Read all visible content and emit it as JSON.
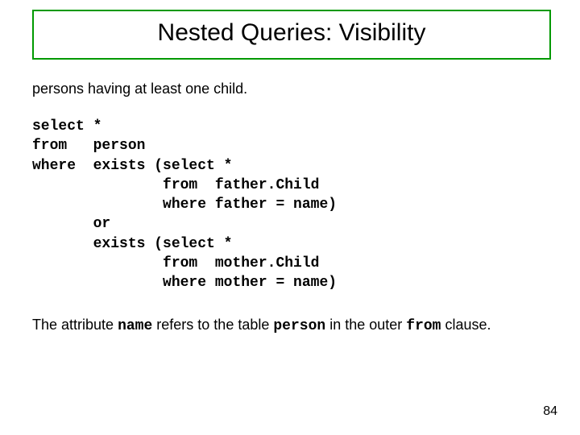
{
  "title": "Nested Queries: Visibility",
  "intro": "persons having at least one child.",
  "code": "select *\nfrom   person\nwhere  exists (select *\n               from  father.Child\n               where father = name)\n       or\n       exists (select *\n               from  mother.Child\n               where mother = name)",
  "note": {
    "p1": "The attribute ",
    "c1": "name",
    "p2": " refers to the table ",
    "c2": "person",
    "p3": " in the outer ",
    "c3": "from",
    "p4": " clause."
  },
  "page_number": "84"
}
